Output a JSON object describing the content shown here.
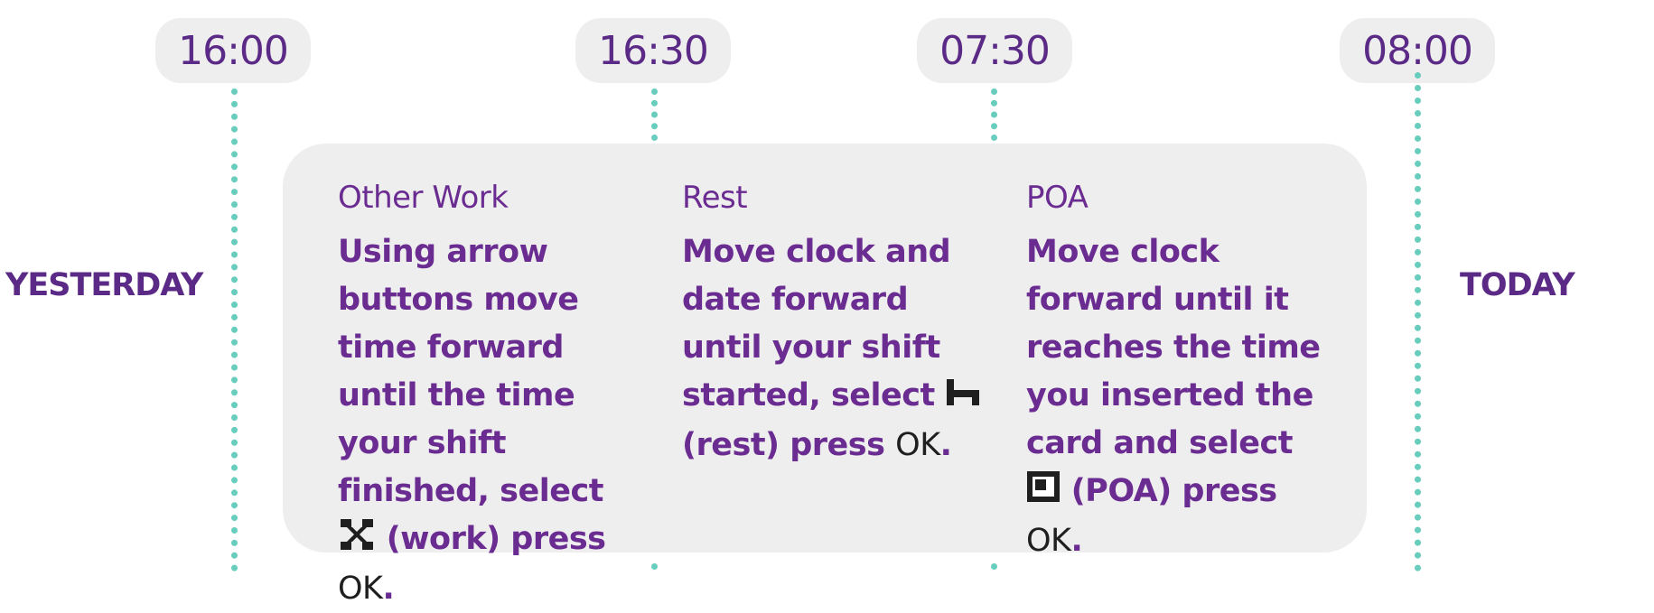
{
  "times": [
    "16:00",
    "16:30",
    "07:30",
    "08:00"
  ],
  "labels": {
    "left": "YESTERDAY",
    "right": "TODAY"
  },
  "columns": [
    {
      "title": "Other Work",
      "text_before_icon": "Using arrow buttons move time forward until the time your shift finished, select",
      "icon": "work-crossed-hammers-icon",
      "text_after_icon": "(work) press",
      "ok": "OK",
      "end": "."
    },
    {
      "title": "Rest",
      "text_before_icon": "Move clock and date forward until your shift started, select",
      "icon": "rest-bed-icon",
      "text_after_icon": "(rest) press",
      "ok": "OK",
      "end": "."
    },
    {
      "title": "POA",
      "text_before_icon": "Move clock forward until it reaches the time you inserted the card and select",
      "icon": "poa-box-icon",
      "text_after_icon": "(POA) press",
      "ok": "OK",
      "end": "."
    }
  ],
  "colors": {
    "accent": "#5b2a86",
    "dotted_line": "#68cdbd",
    "panel": "#eeeeee",
    "ok_text": "#1f1f1f"
  }
}
